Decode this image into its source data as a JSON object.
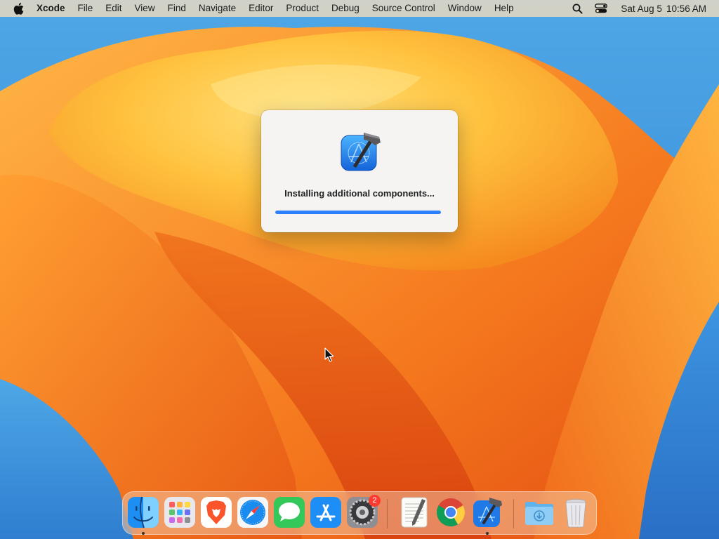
{
  "menubar": {
    "app_name": "Xcode",
    "items": [
      "File",
      "Edit",
      "View",
      "Find",
      "Navigate",
      "Editor",
      "Product",
      "Debug",
      "Source Control",
      "Window",
      "Help"
    ],
    "date": "Sat Aug 5",
    "time": "10:56 AM"
  },
  "dialog": {
    "message": "Installing additional components...",
    "progress_percent": 100,
    "accent_color": "#2d7ff9"
  },
  "dock": {
    "items": [
      {
        "app": "Finder",
        "icon": "finder-icon",
        "running": true
      },
      {
        "app": "Launchpad",
        "icon": "launchpad-icon",
        "running": false
      },
      {
        "app": "Brave Browser",
        "icon": "brave-icon",
        "running": false
      },
      {
        "app": "Safari",
        "icon": "safari-icon",
        "running": false
      },
      {
        "app": "Messages",
        "icon": "messages-icon",
        "running": false
      },
      {
        "app": "App Store",
        "icon": "app-store-icon",
        "running": false
      },
      {
        "app": "System Settings",
        "icon": "system-settings-icon",
        "running": false,
        "badge": "2"
      },
      {
        "app": "TextEdit",
        "icon": "textedit-icon",
        "running": false
      },
      {
        "app": "Google Chrome",
        "icon": "chrome-icon",
        "running": false
      },
      {
        "app": "Xcode",
        "icon": "xcode-icon",
        "running": true
      },
      {
        "app": "Downloads",
        "icon": "downloads-folder-icon",
        "running": false
      },
      {
        "app": "Trash",
        "icon": "trash-icon",
        "running": false
      }
    ]
  }
}
